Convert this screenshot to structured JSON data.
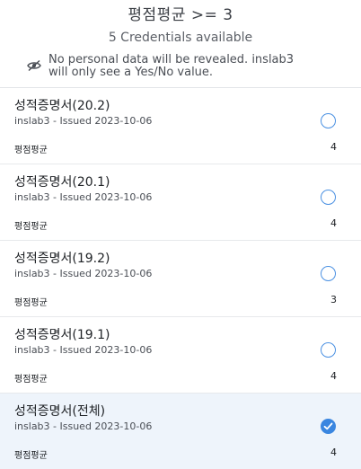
{
  "header": {
    "title": "평점평균 >= 3",
    "subtitle": "5 Credentials available",
    "notice": "No personal data will be revealed. inslab3\nwill only see a Yes/No value."
  },
  "credentials": [
    {
      "title": "성적증명서(20.2)",
      "issued": "inslab3 - Issued 2023-10-06",
      "label": "평점평균",
      "value": "4",
      "selected": false
    },
    {
      "title": "성적증명서(20.1)",
      "issued": "inslab3 - Issued 2023-10-06",
      "label": "평점평균",
      "value": "4",
      "selected": false
    },
    {
      "title": "성적증명서(19.2)",
      "issued": "inslab3 - Issued 2023-10-06",
      "label": "평점평균",
      "value": "3",
      "selected": false
    },
    {
      "title": "성적증명서(19.1)",
      "issued": "inslab3 - Issued 2023-10-06",
      "label": "평점평균",
      "value": "4",
      "selected": false
    },
    {
      "title": "성적증명서(전체)",
      "issued": "inslab3 - Issued 2023-10-06",
      "label": "평점평균",
      "value": "4",
      "selected": true
    }
  ],
  "icons": {
    "notice": "eye-off-icon",
    "selected": "checkmark-icon"
  },
  "colors": {
    "accent": "#3a86e0",
    "selected_row": "#eef4fb"
  }
}
